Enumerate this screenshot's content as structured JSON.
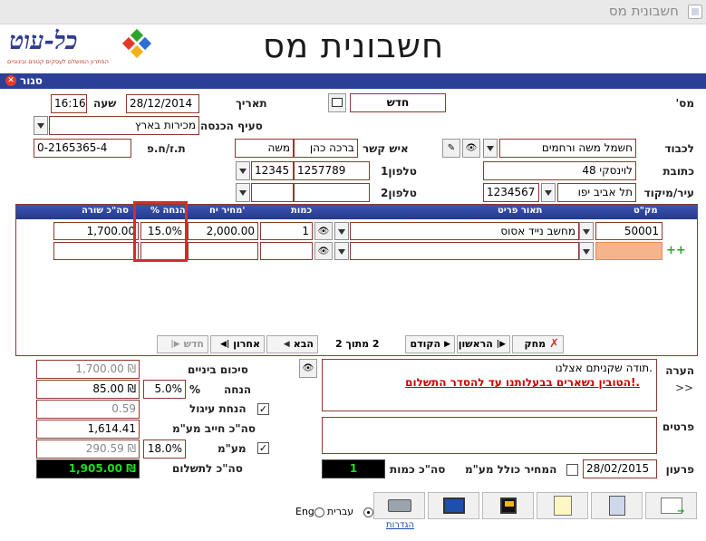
{
  "window": {
    "title": "חשבונית מס"
  },
  "header": {
    "heading": "חשבונית מס",
    "logo_text": "כל-עוט",
    "logo_subtitle": "הפתרון המושלם לעסקים קטנים ובינוניים"
  },
  "bar": {
    "close_label": "סגור"
  },
  "doc": {
    "number_label": "מס'",
    "number_value": "חדש",
    "date_label": "תאריך",
    "date_value": "28/12/2014",
    "time_label": "שעה",
    "time_value": "16:16",
    "income_label": "סעיף הכנסה",
    "income_value": "מכירות בארץ"
  },
  "customer": {
    "to_label": "לכבוד",
    "to_value": "חשמל משה ורחמים",
    "contact_label": "איש קשר",
    "contact_last": "ברכה כהן",
    "contact_first": "משה",
    "id_label": "ת.ז/ח.פ",
    "id_value": "0-2165365-4",
    "address_label": "כתובת",
    "address_value": "לוינסקי 48",
    "phone1_label": "טלפון1",
    "phone1_value": "1257789",
    "phone1_prefix": "12345",
    "city_label": "עיר/מיקוד",
    "city_value": "תל אביב יפו",
    "zip_value": "1234567",
    "phone2_label": "טלפון2",
    "phone2_value": "",
    "phone2_prefix": ""
  },
  "grid": {
    "columns": [
      "מק\"ט",
      "תאור פריט",
      "כמות",
      "מחיר יח'",
      "% הנחה",
      "סה\"כ שורה"
    ],
    "rows": [
      {
        "sku": "50001",
        "desc": "מחשב נייד אסוס",
        "qty": "1",
        "price": "2,000.00",
        "discount": "15.0%",
        "total": "1,700.00"
      },
      {
        "sku": "",
        "desc": "",
        "qty": "",
        "price": "",
        "discount": "",
        "total": ""
      }
    ],
    "add_symbol": "++",
    "nav": {
      "delete": "מחק",
      "first": "הראשון",
      "prev": "הקודם",
      "pager": "2 מתוך 2",
      "next": "הבא",
      "last": "אחרון",
      "new": "חדש"
    }
  },
  "totals": {
    "subtotal_label": "סיכום ביניים",
    "subtotal_value": "1,700.00 ₪",
    "discount_label": "הנחה",
    "discount_pct_label": "%",
    "discount_pct": "5.0%",
    "discount_value": "85.00 ₪",
    "rounding_label": "הנחת עיגול",
    "rounding_value": "0.59",
    "taxable_label": "סה\"כ חייב מע\"מ",
    "taxable_value": "1,614.41",
    "vat_label": "מע\"מ",
    "vat_pct": "18.0%",
    "vat_value": "290.59 ₪",
    "total_label": "סה\"כ לתשלום",
    "total_value": "1,905.00 ₪"
  },
  "notes": {
    "remark_label": "הערה",
    "remark_line1": ".תודה שקניתם אצלנו",
    "remark_line2": ".!הטובין נשארים בבעלותנו עד להסדר התשלום",
    "expand_label": ">>",
    "details_label": "פרטים",
    "details_value": "",
    "due_label": "פרעון",
    "due_value": "28/02/2015",
    "incl_vat_label": "המחיר כולל מע\"מ",
    "qty_total_label": "סה\"כ כמות",
    "qty_total_value": "1"
  },
  "footer": {
    "lang_he": "עברית",
    "lang_en": "Eng",
    "settings_label": "הגדרות"
  },
  "colors": {
    "accent": "#2b3f97",
    "field_border": "#8b3a2f",
    "total_bg": "#000000",
    "total_fg": "#22dd22",
    "sku_highlight": "#f5b48a",
    "warning_text": "#cc0000"
  }
}
